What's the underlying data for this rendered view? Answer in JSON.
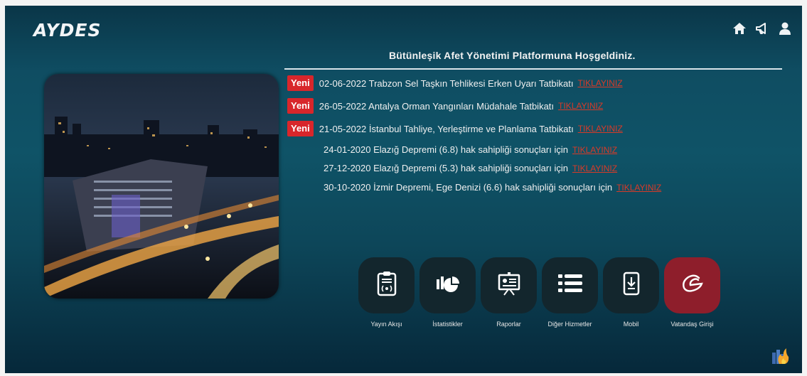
{
  "header": {
    "logo": "AYDES",
    "icons": [
      "home-icon",
      "megaphone-icon",
      "user-icon"
    ]
  },
  "welcome_title": "Bütünleşik Afet Yönetimi Platformuna Hoşgeldiniz.",
  "news": [
    {
      "badge": "Yeni",
      "text": "02-06-2022 Trabzon Sel Taşkın Tehlikesi Erken Uyarı Tatbikatı",
      "link": "TIKLAYINIZ"
    },
    {
      "badge": "Yeni",
      "text": "26-05-2022 Antalya Orman Yangınları Müdahale Tatbikatı",
      "link": "TIKLAYINIZ"
    },
    {
      "badge": "Yeni",
      "text": "21-05-2022 İstanbul Tahliye, Yerleştirme ve Planlama Tatbikatı",
      "link": "TIKLAYINIZ"
    },
    {
      "badge": "",
      "text": "24-01-2020 Elazığ Depremi (6.8) hak sahipliği sonuçları için",
      "link": "TIKLAYINIZ"
    },
    {
      "badge": "",
      "text": "27-12-2020 Elazığ Depremi (5.3) hak sahipliği sonuçları için",
      "link": "TIKLAYINIZ"
    },
    {
      "badge": "",
      "text": "30-10-2020 İzmir Depremi, Ege Denizi (6.6) hak sahipliği sonuçları için",
      "link": "TIKLAYINIZ"
    }
  ],
  "services": [
    {
      "label": "Yayın Akışı",
      "icon": "broadcast-clipboard-icon"
    },
    {
      "label": "İstatistikler",
      "icon": "statistics-icon"
    },
    {
      "label": "Raporlar",
      "icon": "presentation-icon"
    },
    {
      "label": "Diğer Hizmetler",
      "icon": "list-icon"
    },
    {
      "label": "Mobil",
      "icon": "mobile-download-icon"
    },
    {
      "label": "Vatandaş Girişi",
      "icon": "e-devlet-icon"
    }
  ],
  "colors": {
    "background": "#0f4d62",
    "badge": "#d8262b",
    "link": "#d83a28",
    "tile": "#13262d",
    "tile_citizen": "#8e1e2b"
  }
}
